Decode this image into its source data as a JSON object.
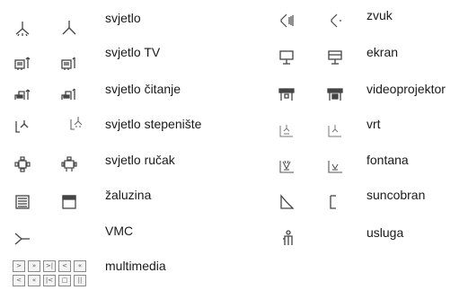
{
  "left": [
    {
      "label": "svjetlo",
      "icon": "ceiling-light-icon"
    },
    {
      "label": "svjetlo TV",
      "icon": "tv-light-icon"
    },
    {
      "label": "svjetlo čitanje",
      "icon": "reading-light-icon"
    },
    {
      "label": "svjetlo stepenište",
      "icon": "stairs-light-icon"
    },
    {
      "label": "svjetlo ručak",
      "icon": "dining-light-icon"
    },
    {
      "label": "žaluzina",
      "icon": "blinds-icon"
    },
    {
      "label": "VMC",
      "icon": "ventilation-icon"
    },
    {
      "label": "multimedia",
      "icon": "multimedia-controls-icon"
    }
  ],
  "right": [
    {
      "label": "zvuk",
      "icon": "speaker-icon"
    },
    {
      "label": "ekran",
      "icon": "screen-icon"
    },
    {
      "label": "videoprojektor",
      "icon": "projector-icon"
    },
    {
      "label": "vrt",
      "icon": "garden-icon"
    },
    {
      "label": "fontana",
      "icon": "fountain-icon"
    },
    {
      "label": "suncobran",
      "icon": "parasol-icon"
    },
    {
      "label": "usluga",
      "icon": "service-person-icon"
    }
  ],
  "multimedia_buttons": {
    "row1": [
      ">",
      "»",
      ">|",
      "<",
      "«"
    ],
    "row2": [
      "<",
      "«",
      "|<",
      "□",
      "||"
    ]
  }
}
